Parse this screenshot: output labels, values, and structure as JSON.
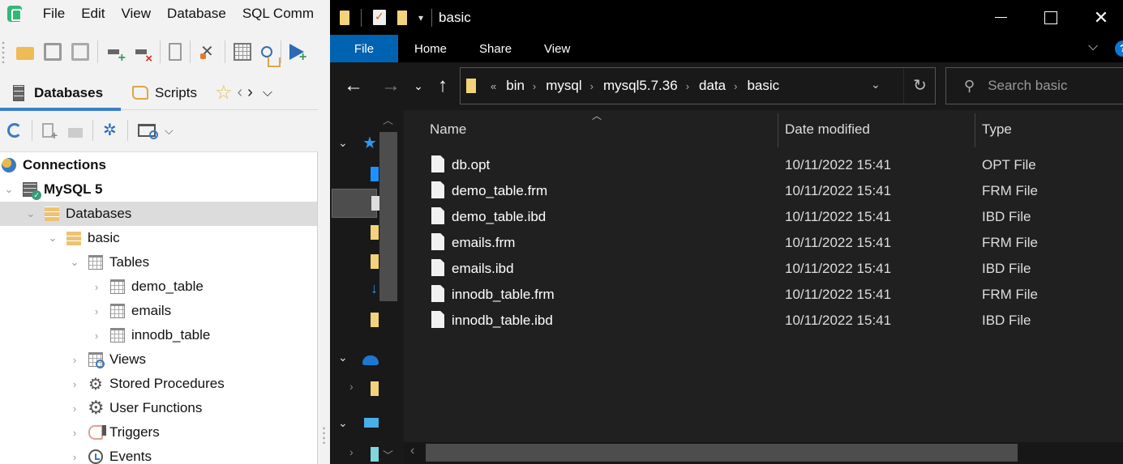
{
  "dbtool": {
    "menu": [
      "File",
      "Edit",
      "View",
      "Database",
      "SQL Comm"
    ],
    "toolbar_icons": [
      "open-folder-icon",
      "save-icon",
      "save-all-icon",
      "new-connection-icon",
      "disconnect-icon",
      "new-query-icon",
      "tools-icon",
      "scheduler-table-icon",
      "scheduler-icon",
      "run-icon"
    ],
    "tabs": [
      {
        "label": "Databases",
        "active": true
      },
      {
        "label": "Scripts",
        "active": false
      }
    ],
    "tree": [
      {
        "label": "Connections",
        "level": 0,
        "icon": "globe",
        "bold": true,
        "chevron": ""
      },
      {
        "label": "MySQL 5",
        "level": 0,
        "icon": "server",
        "bold": true,
        "chevron": "down"
      },
      {
        "label": "Databases",
        "level": 1,
        "icon": "db",
        "chevron": "down",
        "selected": true
      },
      {
        "label": "basic",
        "level": 2,
        "icon": "db",
        "chevron": "down"
      },
      {
        "label": "Tables",
        "level": 3,
        "icon": "table",
        "chevron": "down"
      },
      {
        "label": "demo_table",
        "level": 4,
        "icon": "table",
        "chevron": "right"
      },
      {
        "label": "emails",
        "level": 4,
        "icon": "table",
        "chevron": "right"
      },
      {
        "label": "innodb_table",
        "level": 4,
        "icon": "table",
        "chevron": "right"
      },
      {
        "label": "Views",
        "level": 3,
        "icon": "view",
        "chevron": "right"
      },
      {
        "label": "Stored Procedures",
        "level": 3,
        "icon": "gears",
        "chevron": "right"
      },
      {
        "label": "User Functions",
        "level": 3,
        "icon": "gear",
        "chevron": "right"
      },
      {
        "label": "Triggers",
        "level": 3,
        "icon": "trigger",
        "chevron": "right"
      },
      {
        "label": "Events",
        "level": 3,
        "icon": "clock",
        "chevron": "right"
      }
    ]
  },
  "explorer": {
    "title": "basic",
    "window_controls": {
      "close": "✕"
    },
    "ribbon": {
      "tabs": [
        "File",
        "Home",
        "Share",
        "View"
      ],
      "help": "?"
    },
    "nav": {
      "back": "←",
      "forward": "→",
      "recent": "⌄",
      "up": "↑"
    },
    "address": {
      "more": "«",
      "crumbs": [
        "bin",
        "mysql",
        "mysql5.7.36",
        "data",
        "basic"
      ],
      "separator": "›",
      "refresh": "↻"
    },
    "search": {
      "placeholder": "Search basic"
    },
    "columns": [
      "Name",
      "Date modified",
      "Type"
    ],
    "files": [
      {
        "name": "db.opt",
        "date": "10/11/2022 15:41",
        "type": "OPT File"
      },
      {
        "name": "demo_table.frm",
        "date": "10/11/2022 15:41",
        "type": "FRM File"
      },
      {
        "name": "demo_table.ibd",
        "date": "10/11/2022 15:41",
        "type": "IBD File"
      },
      {
        "name": "emails.frm",
        "date": "10/11/2022 15:41",
        "type": "FRM File"
      },
      {
        "name": "emails.ibd",
        "date": "10/11/2022 15:41",
        "type": "IBD File"
      },
      {
        "name": "innodb_table.frm",
        "date": "10/11/2022 15:41",
        "type": "FRM File"
      },
      {
        "name": "innodb_table.ibd",
        "date": "10/11/2022 15:41",
        "type": "IBD File"
      }
    ]
  }
}
